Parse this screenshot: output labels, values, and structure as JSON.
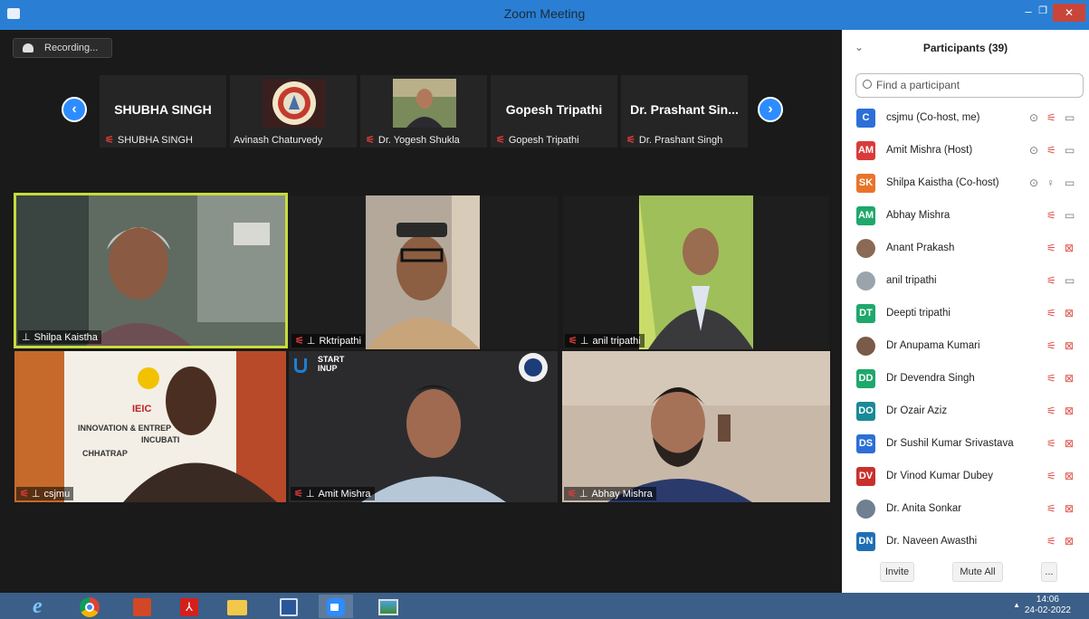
{
  "window": {
    "title": "Zoom Meeting",
    "minimize": "–",
    "restore": "❐",
    "close": "✕"
  },
  "recording": {
    "label": "Recording..."
  },
  "strip": {
    "prev": "‹",
    "next": "›",
    "thumbs": [
      {
        "name": "SHUBHA SINGH",
        "label": "SHUBHA SINGH",
        "muted": true
      },
      {
        "name": "",
        "label": "Avinash Chaturvedy",
        "muted": false
      },
      {
        "name": "",
        "label": "Dr. Yogesh Shukla",
        "muted": true
      },
      {
        "name": "Gopesh Tripathi",
        "label": "Gopesh Tripathi",
        "muted": true
      },
      {
        "name": "Dr. Prashant Sin...",
        "label": "Dr. Prashant Singh",
        "muted": true
      }
    ]
  },
  "gallery": [
    {
      "label": "Shilpa Kaistha",
      "muted": false,
      "active": true
    },
    {
      "label": "Rktripathi",
      "muted": true,
      "active": false
    },
    {
      "label": "anil tripathi",
      "muted": true,
      "active": false
    },
    {
      "label": "csjmu",
      "muted": true,
      "active": false
    },
    {
      "label": "Amit Mishra",
      "muted": true,
      "active": false
    },
    {
      "label": "Abhay Mishra",
      "muted": true,
      "active": false
    }
  ],
  "tile_texts": {
    "csjmu_banner_1": "IEIC",
    "csjmu_banner_2": "INNOVATION & ENTREP",
    "csjmu_banner_3": "INCUBATI",
    "csjmu_banner_4": "CHHATRAP",
    "amit_logo_1": "START",
    "amit_logo_2": "INUP"
  },
  "participants": {
    "title": "Participants (39)",
    "search_placeholder": "Find a participant",
    "invite": "Invite",
    "mute_all": "Mute All",
    "more": "...",
    "list": [
      {
        "initials": "C",
        "color": "#2d6fd6",
        "name": "csjmu (Co-host, me)",
        "rec": true,
        "mic": "muted",
        "video": "on"
      },
      {
        "initials": "AM",
        "color": "#d93b3b",
        "name": "Amit Mishra (Host)",
        "rec": true,
        "mic": "muted",
        "video": "on"
      },
      {
        "initials": "SK",
        "color": "#e8742a",
        "name": "Shilpa Kaistha (Co-host)",
        "rec": true,
        "mic": "on",
        "video": "on"
      },
      {
        "initials": "AM",
        "color": "#1ea86b",
        "name": "Abhay Mishra",
        "rec": false,
        "mic": "muted",
        "video": "on"
      },
      {
        "initials": "",
        "color": "#8a6a55",
        "name": "Anant Prakash",
        "rec": false,
        "mic": "muted",
        "video": "off"
      },
      {
        "initials": "",
        "color": "#9aa4ad",
        "name": "anil tripathi",
        "rec": false,
        "mic": "muted",
        "video": "on"
      },
      {
        "initials": "DT",
        "color": "#1ea86b",
        "name": "Deepti tripathi",
        "rec": false,
        "mic": "muted",
        "video": "off"
      },
      {
        "initials": "",
        "color": "#7a5a48",
        "name": "Dr Anupama Kumari",
        "rec": false,
        "mic": "muted",
        "video": "off"
      },
      {
        "initials": "DD",
        "color": "#1ea86b",
        "name": "Dr Devendra Singh",
        "rec": false,
        "mic": "muted",
        "video": "off"
      },
      {
        "initials": "DO",
        "color": "#1a8a96",
        "name": "Dr Ozair Aziz",
        "rec": false,
        "mic": "muted",
        "video": "off"
      },
      {
        "initials": "DS",
        "color": "#2d6fd6",
        "name": "Dr Sushil Kumar Srivastava",
        "rec": false,
        "mic": "muted",
        "video": "off"
      },
      {
        "initials": "DV",
        "color": "#c9302c",
        "name": "Dr Vinod Kumar Dubey",
        "rec": false,
        "mic": "muted",
        "video": "off"
      },
      {
        "initials": "",
        "color": "#6f8090",
        "name": "Dr. Anita Sonkar",
        "rec": false,
        "mic": "muted",
        "video": "off"
      },
      {
        "initials": "DN",
        "color": "#1f6fb5",
        "name": "Dr. Naveen Awasthi",
        "rec": false,
        "mic": "muted",
        "video": "off"
      }
    ]
  },
  "taskbar": {
    "apps": [
      "internet-explorer-icon",
      "chrome-icon",
      "powerpoint-icon",
      "acrobat-icon",
      "file-explorer-icon",
      "word-icon",
      "zoom-icon",
      "photos-icon"
    ],
    "time": "14:06",
    "date": "24-02-2022",
    "tray_arrow": "▲"
  },
  "icons": {
    "mic_muted": "🎙",
    "mic": "🎙",
    "video": "▭",
    "rec": "⊙",
    "pin": "🖈"
  }
}
